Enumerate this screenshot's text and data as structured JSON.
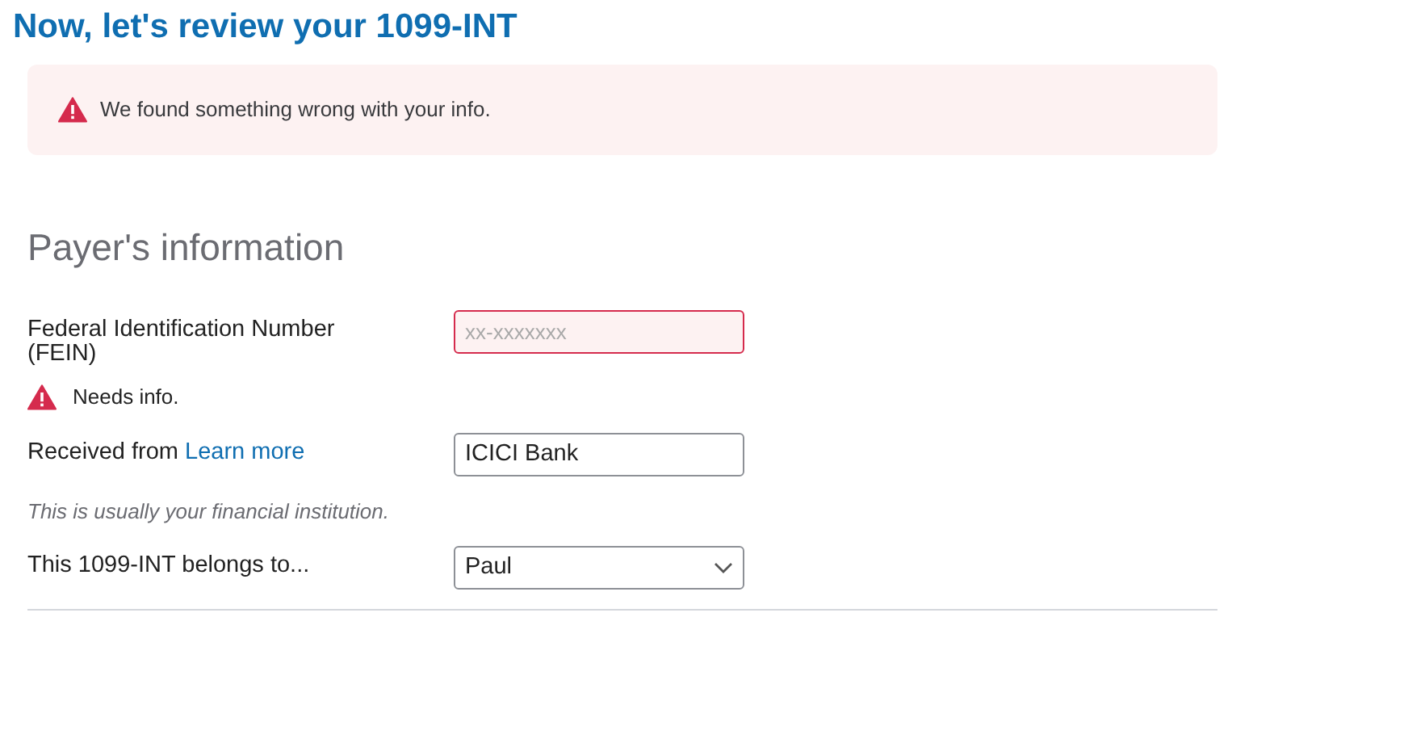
{
  "page_title": "Now, let's review your 1099-INT",
  "alert": {
    "message": "We found something wrong with your info."
  },
  "section_title": "Payer's information",
  "fields": [
    {
      "kind": "text",
      "label": "Federal Identification Number (FEIN)",
      "placeholder": "xx-xxxxxxx",
      "invalid": true,
      "error": "Needs info."
    },
    {
      "kind": "text",
      "label": "Received from",
      "link": "Learn more",
      "value": "ICICI Bank",
      "invalid": false,
      "hint": "This is usually your financial institution."
    },
    {
      "kind": "select",
      "label": "This 1099-INT belongs to...",
      "value": "Paul"
    }
  ]
}
